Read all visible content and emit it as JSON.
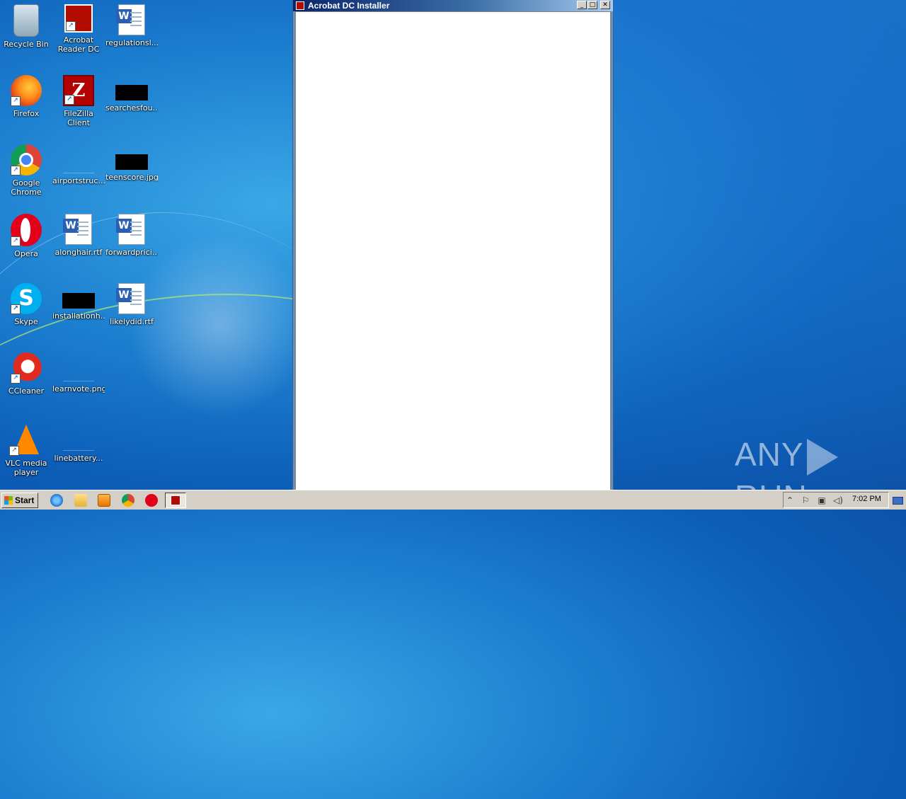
{
  "desktop": {
    "icons": [
      {
        "label": "Recycle Bin"
      },
      {
        "label": "Acrobat\nReader DC"
      },
      {
        "label": "regulationsl..."
      },
      {
        "label": "Firefox"
      },
      {
        "label": "FileZilla Client"
      },
      {
        "label": "searchesfou..."
      },
      {
        "label": "Google\nChrome"
      },
      {
        "label": "airportstruc..."
      },
      {
        "label": "teenscore.jpg"
      },
      {
        "label": "Opera"
      },
      {
        "label": "alonghair.rtf"
      },
      {
        "label": "forwardprici..."
      },
      {
        "label": "Skype"
      },
      {
        "label": "installationh..."
      },
      {
        "label": "likelydid.rtf"
      },
      {
        "label": "CCleaner"
      },
      {
        "label": "learnvote.png"
      },
      {
        "label": "VLC media\nplayer"
      },
      {
        "label": "linebattery..."
      }
    ]
  },
  "window": {
    "title": "Acrobat DC Installer",
    "minimize_glyph": "_",
    "maximize_glyph": "□",
    "close_glyph": "✕"
  },
  "taskbar": {
    "start_label": "Start",
    "clock": "7:02 PM",
    "tray_expand_glyph": "⌃",
    "tray_flag_glyph": "⚐",
    "tray_network_glyph": "▣",
    "tray_volume_glyph": "◁)"
  },
  "watermark": {
    "left_text": "ANY",
    "right_text": "RUN"
  }
}
